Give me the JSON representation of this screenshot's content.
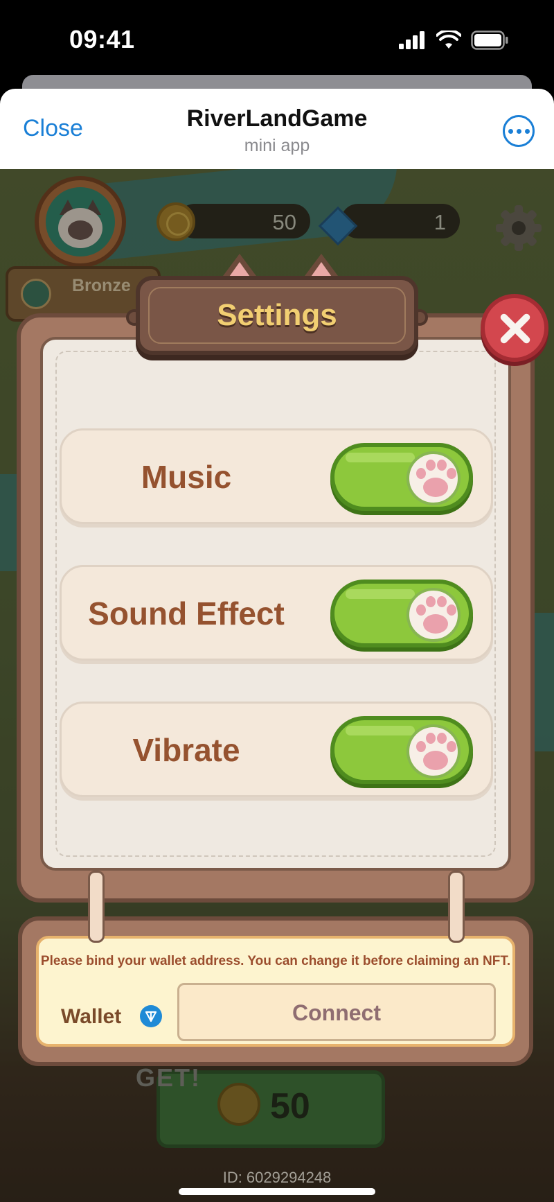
{
  "status_bar": {
    "time": "09:41"
  },
  "header": {
    "close_label": "Close",
    "title": "RiverLandGame",
    "subtitle": "mini app"
  },
  "hud": {
    "rank": "Bronze",
    "coins": "50",
    "gems": "1"
  },
  "settings": {
    "title": "Settings",
    "rows": [
      {
        "label": "Music",
        "enabled": true
      },
      {
        "label": "Sound Effect",
        "enabled": true
      },
      {
        "label": "Vibrate",
        "enabled": true
      }
    ]
  },
  "wallet": {
    "notice": "Please bind your wallet address. You can change it before claiming an NFT.",
    "label": "Wallet",
    "connect_label": "Connect"
  },
  "reward": {
    "get_label": "GET!",
    "value": "50"
  },
  "player": {
    "id_text": "ID: 6029294248"
  },
  "colors": {
    "accent_blue": "#1a7fd6",
    "toggle_on": "#8dc83c",
    "close_red": "#d3474e",
    "title_gold": "#f2cf72"
  }
}
